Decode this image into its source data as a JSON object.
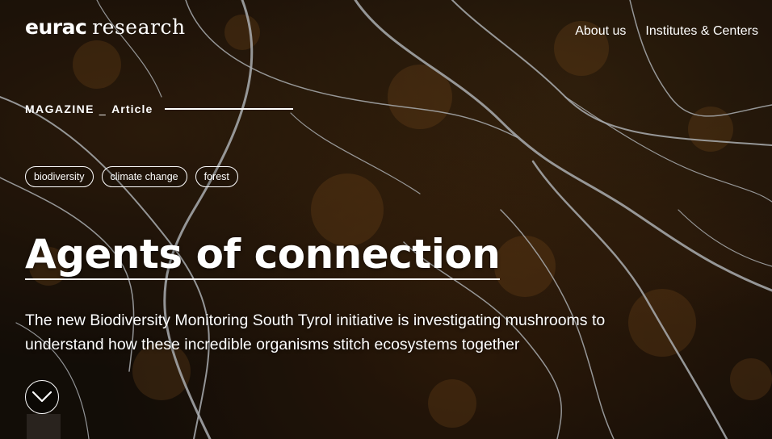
{
  "header": {
    "logo_bold": "eurac",
    "logo_light": "research",
    "nav": [
      "About us",
      "Institutes & Centers"
    ]
  },
  "article": {
    "section": "MAGAZINE",
    "separator": "_",
    "type": "Article",
    "tags": [
      "biodiversity",
      "climate change",
      "forest"
    ],
    "title": "Agents of connection",
    "lead": "The new Biodiversity Monitoring South Tyrol initiative is investigating mushrooms to understand how these incredible organisms stitch ecosystems together"
  },
  "icons": {
    "scroll": "chevron-down-icon"
  },
  "colors": {
    "text": "#ffffff",
    "background": "#1a120b",
    "mycelium": "#e8eef2"
  }
}
